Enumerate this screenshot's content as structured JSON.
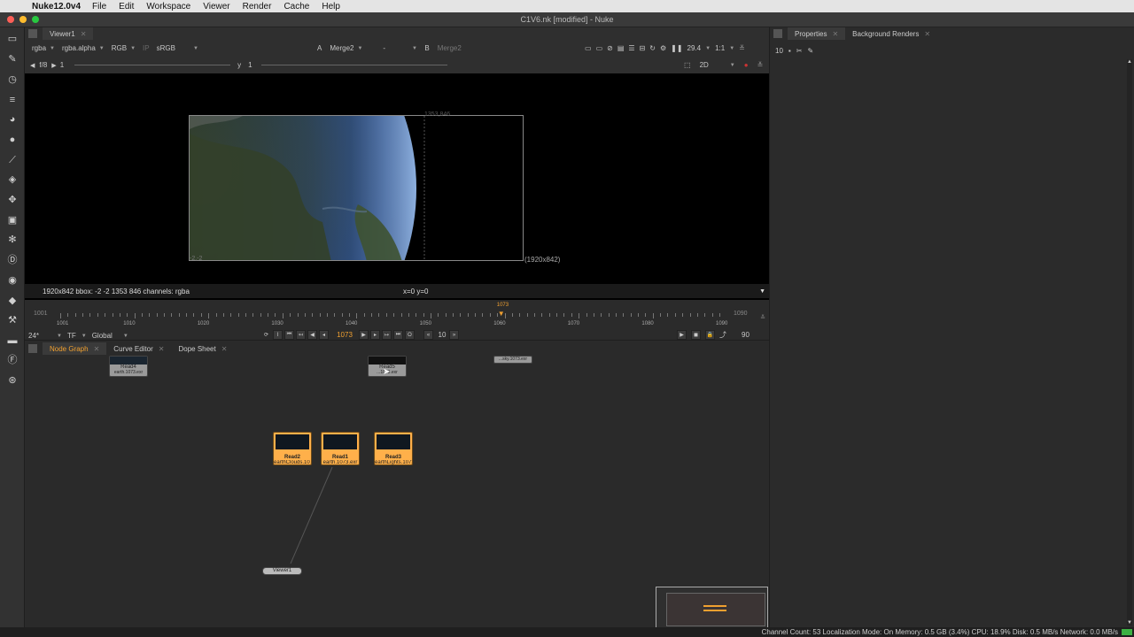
{
  "menubar": {
    "apple_icon": "apple-icon",
    "app_name": "Nuke12.0v4",
    "items": [
      "File",
      "Edit",
      "Workspace",
      "Viewer",
      "Render",
      "Cache",
      "Help"
    ]
  },
  "window": {
    "title": "C1V6.nk [modified] - Nuke",
    "traffic_lights": {
      "close": "#fe5f57",
      "minimize": "#febc2e",
      "maximize": "#28c840"
    }
  },
  "toolbar": {
    "icons": [
      "image-icon",
      "draw-icon",
      "time-icon",
      "channel-icon",
      "color-icon",
      "filter-icon",
      "keyer-icon",
      "merge-icon",
      "transform-icon",
      "3d-icon",
      "particles-icon",
      "deep-icon",
      "views-icon",
      "metadata-icon",
      "toolsets-icon",
      "other-icon",
      "furnace-icon",
      "cara-icon"
    ]
  },
  "viewer": {
    "tab": "Viewer1",
    "channels": "rgba",
    "alpha": "rgba.alpha",
    "colorspace_rgb": "RGB",
    "ip": "IP",
    "lut": "sRGB",
    "a_label": "A",
    "a_input": "Merge2",
    "compare": "-",
    "b_label": "B",
    "b_input": "Merge2",
    "fps_zoom": "29.4",
    "ratio": "1:1",
    "fstop": "f/8",
    "gain": "1",
    "gamma_label": "y",
    "gamma": "1",
    "view_mode": "2D",
    "bbox_label": "1353,846",
    "origin_label": "-2,-2",
    "format_label": "(1920x842)",
    "status_info": "1920x842  bbox: -2 -2 1353 846 channels: rgba",
    "status_coords": "x=0 y=0"
  },
  "timeline": {
    "start": "1001",
    "end": "1090",
    "current": "1073",
    "labels": [
      "1001",
      "1010",
      "1020",
      "1030",
      "1040",
      "1050",
      "1060",
      "1070",
      "1080",
      "1090"
    ],
    "fps": "24*",
    "tf": "TF",
    "scope": "Global",
    "current_frame": "1073",
    "step": "10",
    "end_frame": "90",
    "playhead_position": 0.669
  },
  "node_graph": {
    "tabs": [
      "Node Graph",
      "Curve Editor",
      "Dope Sheet"
    ],
    "nodes": [
      {
        "name": "Read4",
        "file": "earth.1073.exr",
        "style": "gray"
      },
      {
        "name": "Read5",
        "file": "...1073.exr",
        "style": "gray"
      },
      {
        "name": "",
        "file": "...sky.1073.exr",
        "style": "gray"
      },
      {
        "name": "Read2",
        "file": "earthClouds.1073",
        "style": "orange"
      },
      {
        "name": "Read1",
        "file": "earth.1073.exr",
        "style": "orange"
      },
      {
        "name": "Read3",
        "file": "earthLights.1073",
        "style": "orange"
      },
      {
        "name": "Viewer1",
        "file": "",
        "style": "viewer"
      }
    ]
  },
  "properties": {
    "tabs": [
      "Properties",
      "Background Renders"
    ],
    "max_panels": "10"
  },
  "footer": {
    "status": "Channel Count: 53  Localization Mode: On  Memory: 0.5 GB (3.4%)  CPU: 18.9%  Disk: 0.5 MB/s  Network: 0.0 MB/s"
  }
}
